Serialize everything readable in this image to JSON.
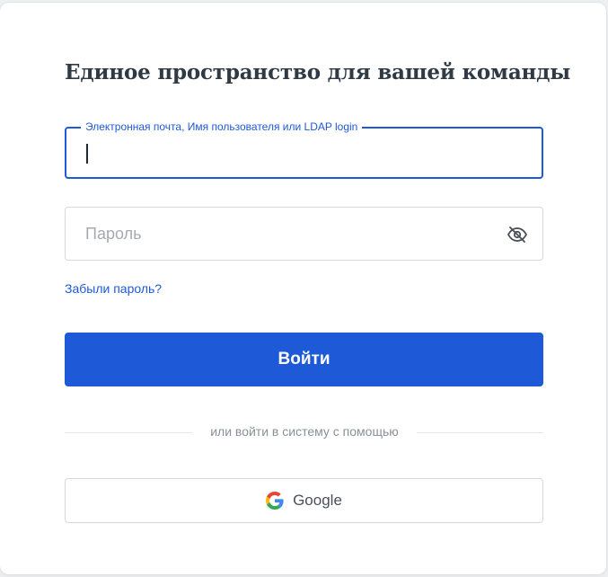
{
  "login": {
    "title": "Единое пространство для вашей команды",
    "email": {
      "label": "Электронная почта, Имя пользователя или LDAP login",
      "value": ""
    },
    "password": {
      "placeholder": "Пароль",
      "value": ""
    },
    "forgot_link": "Забыли пароль?",
    "submit_label": "Войти",
    "divider_text": "или войти в систему с помощью",
    "oauth": {
      "google_label": "Google"
    }
  },
  "icons": {
    "password_toggle": "eye-off-icon",
    "google": "google-logo-icon"
  },
  "colors": {
    "accent": "#1e59d8",
    "title": "#2f3a44",
    "border": "#d5d9de",
    "decoration_gold": "#a77a1c",
    "decoration_blue": "#1e59d8"
  }
}
